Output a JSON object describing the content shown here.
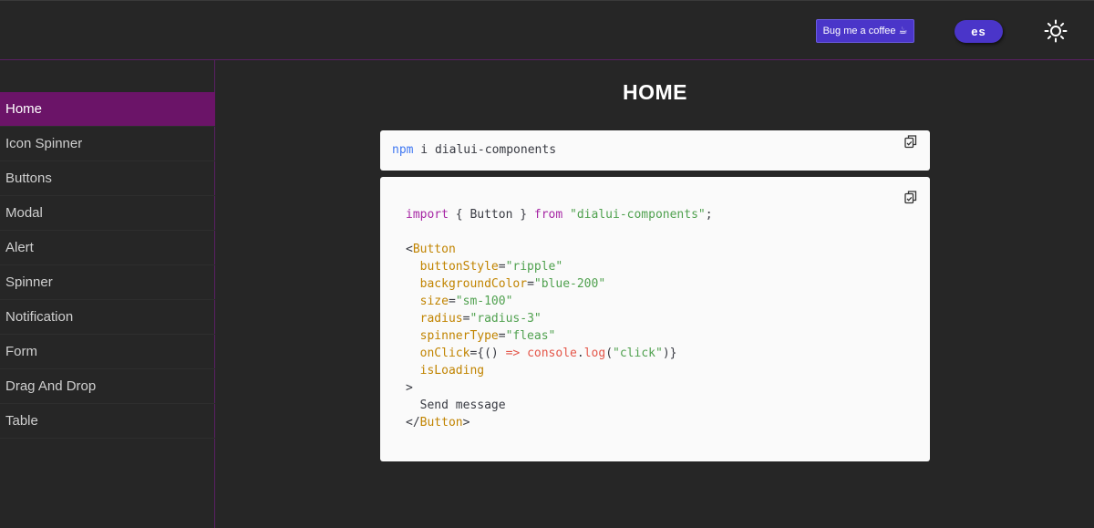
{
  "header": {
    "coffee_label": "Bug me a coffee ☕",
    "lang_label": "es",
    "theme_icon": "sun-icon"
  },
  "sidebar": {
    "items": [
      {
        "label": "Home",
        "active": true
      },
      {
        "label": "Icon Spinner"
      },
      {
        "label": "Buttons"
      },
      {
        "label": "Modal"
      },
      {
        "label": "Alert"
      },
      {
        "label": "Spinner"
      },
      {
        "label": "Notification"
      },
      {
        "label": "Form"
      },
      {
        "label": "Drag And Drop"
      },
      {
        "label": "Table"
      }
    ]
  },
  "main": {
    "title": "HOME",
    "install": {
      "cmd": "npm",
      "rest": " i dialui-components"
    },
    "usage": {
      "import_kw": "import",
      "import_mid": " { Button } ",
      "from_kw": "from",
      "import_str": "\"dialui-components\"",
      "import_end": ";",
      "open_tag": "Button",
      "props": [
        {
          "name": "buttonStyle",
          "value": "\"ripple\""
        },
        {
          "name": "backgroundColor",
          "value": "\"blue-200\""
        },
        {
          "name": "size",
          "value": "\"sm-100\""
        },
        {
          "name": "radius",
          "value": "\"radius-3\""
        },
        {
          "name": "spinnerType",
          "value": "\"fleas\""
        }
      ],
      "onclick_name": "onClick",
      "onclick_parts": [
        "{() ",
        "=>",
        " console",
        ".",
        "log",
        "(",
        "\"click\"",
        ")}"
      ],
      "flag_prop": "isLoading",
      "close_bracket": ">",
      "children": "Send message",
      "close_tag": "Button"
    }
  },
  "colors": {
    "accent": "#4a35c9",
    "active_nav": "#6b1468",
    "background": "#262626",
    "divider": "#5a1f63"
  }
}
